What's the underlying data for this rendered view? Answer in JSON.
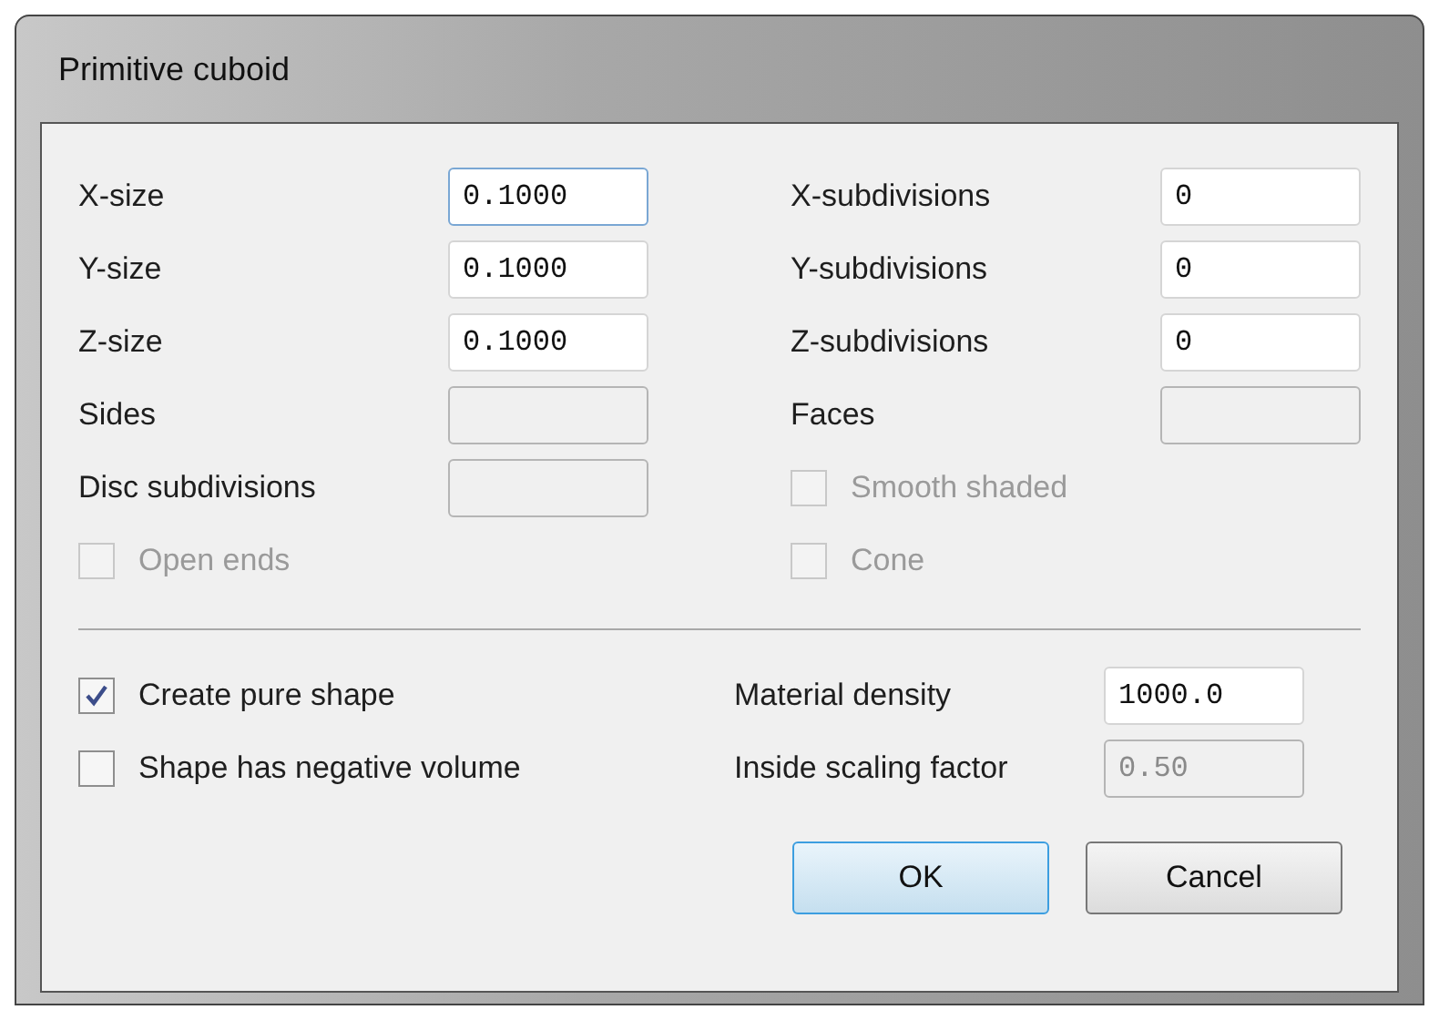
{
  "window": {
    "title": "Primitive cuboid"
  },
  "left": [
    {
      "kind": "field",
      "label": "X-size",
      "value": "0.1000",
      "disabled": false,
      "focused": true
    },
    {
      "kind": "field",
      "label": "Y-size",
      "value": "0.1000",
      "disabled": false,
      "focused": false
    },
    {
      "kind": "field",
      "label": "Z-size",
      "value": "0.1000",
      "disabled": false,
      "focused": false
    },
    {
      "kind": "field",
      "label": "Sides",
      "disabled": true
    },
    {
      "kind": "field",
      "label": "Disc subdivisions",
      "disabled": true
    },
    {
      "kind": "checkbox",
      "label": "Open ends",
      "checked": false,
      "disabled": true
    }
  ],
  "right": [
    {
      "kind": "field",
      "label": "X-subdivisions",
      "value": "0",
      "disabled": false,
      "focused": false
    },
    {
      "kind": "field",
      "label": "Y-subdivisions",
      "value": "0",
      "disabled": false,
      "focused": false
    },
    {
      "kind": "field",
      "label": "Z-subdivisions",
      "value": "0",
      "disabled": false,
      "focused": false
    },
    {
      "kind": "field",
      "label": "Faces",
      "disabled": true
    },
    {
      "kind": "checkbox",
      "label": "Smooth shaded",
      "checked": false,
      "disabled": true
    },
    {
      "kind": "checkbox",
      "label": "Cone",
      "checked": false,
      "disabled": true
    }
  ],
  "bottom_left": [
    {
      "kind": "checkbox",
      "label": "Create pure shape",
      "checked": true,
      "disabled": false
    },
    {
      "kind": "checkbox",
      "label": "Shape has negative volume",
      "checked": false,
      "disabled": false
    }
  ],
  "bottom_right": [
    {
      "kind": "field",
      "label": "Material density",
      "value": "1000.0",
      "disabled": false,
      "focused": false
    },
    {
      "kind": "field",
      "label": "Inside scaling factor",
      "value": "0.50",
      "disabled": true
    }
  ],
  "buttons": [
    {
      "label": "OK",
      "default": true
    },
    {
      "label": "Cancel",
      "default": false
    }
  ]
}
